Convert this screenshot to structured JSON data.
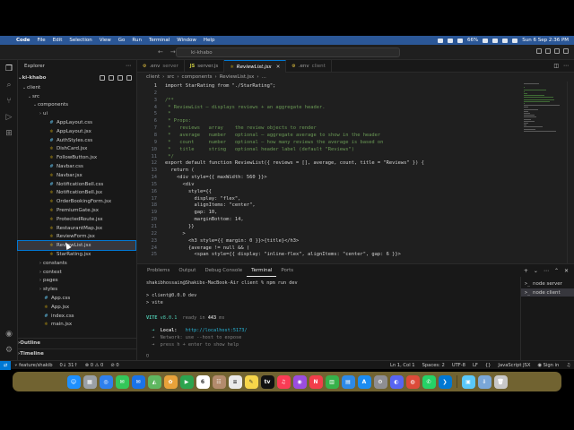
{
  "menubar": {
    "app_name": "Code",
    "items": [
      "File",
      "Edit",
      "Selection",
      "View",
      "Go",
      "Run",
      "Terminal",
      "Window",
      "Help"
    ],
    "battery": "66%",
    "datetime": "Sun 6 Sep  2:36 PM"
  },
  "titlebar": {
    "search_text": "ki-khabo"
  },
  "sidebar": {
    "title": "Explorer",
    "project": "ki-khabo",
    "tree": [
      {
        "name": "client",
        "type": "folder",
        "open": true
      },
      {
        "name": "src",
        "type": "folder",
        "open": true
      },
      {
        "name": "components",
        "type": "folder",
        "open": true
      },
      {
        "name": "ui",
        "type": "folder",
        "open": false
      },
      {
        "name": "AppLayout.css",
        "type": "css"
      },
      {
        "name": "AppLayout.jsx",
        "type": "jsx"
      },
      {
        "name": "AuthStyles.css",
        "type": "css"
      },
      {
        "name": "DishCard.jsx",
        "type": "jsx"
      },
      {
        "name": "FollowButton.jsx",
        "type": "jsx"
      },
      {
        "name": "Navbar.css",
        "type": "css"
      },
      {
        "name": "Navbar.jsx",
        "type": "jsx"
      },
      {
        "name": "NotificationBell.css",
        "type": "css"
      },
      {
        "name": "NotificationBell.jsx",
        "type": "jsx"
      },
      {
        "name": "OrderBookingForm.jsx",
        "type": "jsx"
      },
      {
        "name": "PremiumGate.jsx",
        "type": "jsx"
      },
      {
        "name": "ProtectedRoute.jsx",
        "type": "jsx"
      },
      {
        "name": "RestaurantMap.jsx",
        "type": "jsx"
      },
      {
        "name": "ReviewForm.jsx",
        "type": "jsx"
      },
      {
        "name": "ReviewList.jsx",
        "type": "jsx",
        "selected": true
      },
      {
        "name": "StarRating.jsx",
        "type": "jsx"
      },
      {
        "name": "constants",
        "type": "folder",
        "open": false
      },
      {
        "name": "context",
        "type": "folder",
        "open": false
      },
      {
        "name": "pages",
        "type": "folder",
        "open": false
      },
      {
        "name": "styles",
        "type": "folder",
        "open": false
      },
      {
        "name": "App.css",
        "type": "css"
      },
      {
        "name": "App.jsx",
        "type": "jsx"
      },
      {
        "name": "index.css",
        "type": "css"
      },
      {
        "name": "main.jsx",
        "type": "jsx"
      }
    ],
    "outline_label": "Outline",
    "timeline_label": "Timeline"
  },
  "tabs": [
    {
      "name": ".env",
      "suffix": "server",
      "icon": "env"
    },
    {
      "name": "server.js",
      "suffix": "",
      "icon": "JS"
    },
    {
      "name": "ReviewList.jsx",
      "suffix": "",
      "icon": "jsx",
      "active": true
    },
    {
      "name": ".env",
      "suffix": "client",
      "icon": "env"
    }
  ],
  "breadcrumb": [
    "client",
    "src",
    "components",
    "ReviewList.jsx",
    "..."
  ],
  "editor": {
    "lines": [
      {
        "n": "1",
        "text": "import StarRating from \"./StarRating\";",
        "kind": "code"
      },
      {
        "n": "2",
        "text": "",
        "kind": "code"
      },
      {
        "n": "3",
        "text": "/**",
        "kind": "comment"
      },
      {
        "n": "4",
        "text": " * ReviewList — displays reviews + an aggregate header.",
        "kind": "comment"
      },
      {
        "n": "5",
        "text": " *",
        "kind": "comment"
      },
      {
        "n": "6",
        "text": " * Props:",
        "kind": "comment"
      },
      {
        "n": "7",
        "text": " *   reviews   array    the review objects to render",
        "kind": "comment"
      },
      {
        "n": "8",
        "text": " *   average   number   optional — aggregate average to show in the header",
        "kind": "comment"
      },
      {
        "n": "9",
        "text": " *   count     number   optional — how many reviews the average is based on",
        "kind": "comment"
      },
      {
        "n": "10",
        "text": " *   title     string   optional header label (default \"Reviews\")",
        "kind": "comment"
      },
      {
        "n": "11",
        "text": " */",
        "kind": "comment"
      },
      {
        "n": "12",
        "text": "export default function ReviewList({ reviews = [], average, count, title = \"Reviews\" }) {",
        "kind": "code"
      },
      {
        "n": "13",
        "text": "  return (",
        "kind": "code"
      },
      {
        "n": "14",
        "text": "    <div style={{ maxWidth: 560 }}>",
        "kind": "code"
      },
      {
        "n": "15",
        "text": "      <div",
        "kind": "code"
      },
      {
        "n": "16",
        "text": "        style={{",
        "kind": "code"
      },
      {
        "n": "17",
        "text": "          display: \"flex\",",
        "kind": "code"
      },
      {
        "n": "18",
        "text": "          alignItems: \"center\",",
        "kind": "code"
      },
      {
        "n": "19",
        "text": "          gap: 10,",
        "kind": "code"
      },
      {
        "n": "20",
        "text": "          marginBottom: 14,",
        "kind": "code"
      },
      {
        "n": "21",
        "text": "        }}",
        "kind": "code"
      },
      {
        "n": "22",
        "text": "      >",
        "kind": "code"
      },
      {
        "n": "23",
        "text": "        <h3 style={{ margin: 0 }}>{title}</h3>",
        "kind": "code"
      },
      {
        "n": "24",
        "text": "        {average != null && (",
        "kind": "code"
      },
      {
        "n": "25",
        "text": "          <span style={{ display: \"inline-flex\", alignItems: \"center\", gap: 6 }}>",
        "kind": "code"
      }
    ]
  },
  "panel": {
    "tabs": [
      "Problems",
      "Output",
      "Debug Console",
      "Terminal",
      "Ports"
    ],
    "active_tab": "Terminal",
    "terminal": {
      "prompt": "shakibhossain@Shakibs-MacBook-Air client % npm run dev",
      "script_line1": "> client@0.0.0 dev",
      "script_line2": "> vite",
      "vite_label": "VITE",
      "vite_version": "v8.0.1",
      "ready_text": "ready in",
      "ready_ms": "443",
      "ready_unit": "ms",
      "local_label": "Local:",
      "local_url": "http://localhost:5173/",
      "network_label": "Network:",
      "network_text": "use --host to expose",
      "help_text": "press h + enter to show help"
    },
    "terminal_list": [
      "node server",
      "node client"
    ]
  },
  "statusbar": {
    "branch": "feature/shakib",
    "sync": "0↓ 31↑",
    "errors": "0",
    "warnings": "0",
    "ports": "0",
    "position": "Ln 1, Col 1",
    "spaces": "Spaces: 2",
    "encoding": "UTF-8",
    "eol": "LF",
    "braces": "{}",
    "language": "JavaScript JSX",
    "sign_in": "Sign in"
  },
  "dock": {
    "apps": [
      {
        "icon": "finder",
        "color": "#1e90ff",
        "glyph": "☺"
      },
      {
        "icon": "launchpad",
        "color": "#9aa0a6",
        "glyph": "▦"
      },
      {
        "icon": "safari",
        "color": "#2f80ed",
        "glyph": "◎"
      },
      {
        "icon": "messages",
        "color": "#34c759",
        "glyph": "✉"
      },
      {
        "icon": "mail",
        "color": "#1a73e8",
        "glyph": "✉"
      },
      {
        "icon": "maps",
        "color": "#5fb760",
        "glyph": "◭"
      },
      {
        "icon": "photos",
        "color": "#e8a23a",
        "glyph": "✿"
      },
      {
        "icon": "facetime",
        "color": "#2ca44e",
        "glyph": "▶"
      },
      {
        "icon": "calendar",
        "color": "#ffffff",
        "glyph": "6"
      },
      {
        "icon": "contacts",
        "color": "#b38b6d",
        "glyph": "☷"
      },
      {
        "icon": "reminders",
        "color": "#eaeaea",
        "glyph": "≡"
      },
      {
        "icon": "notes",
        "color": "#f6d54a",
        "glyph": "✎"
      },
      {
        "icon": "tv",
        "color": "#111111",
        "glyph": "tv"
      },
      {
        "icon": "music",
        "color": "#fa3c55",
        "glyph": "♫"
      },
      {
        "icon": "podcasts",
        "color": "#9b4de0",
        "glyph": "◉"
      },
      {
        "icon": "news",
        "color": "#f23e4a",
        "glyph": "N"
      },
      {
        "icon": "numbers",
        "color": "#36b24a",
        "glyph": "▥"
      },
      {
        "icon": "keynote",
        "color": "#2d8ae8",
        "glyph": "▤"
      },
      {
        "icon": "app-store",
        "color": "#1b8cf2",
        "glyph": "A"
      },
      {
        "icon": "system-settings",
        "color": "#8e8e93",
        "glyph": "⚙"
      },
      {
        "icon": "discord",
        "color": "#5865f2",
        "glyph": "◐"
      },
      {
        "icon": "chrome",
        "color": "#dd4b39",
        "glyph": "◍"
      },
      {
        "icon": "whatsapp",
        "color": "#25d366",
        "glyph": "✆"
      },
      {
        "icon": "vscode",
        "color": "#0078d4",
        "glyph": "❯"
      },
      {
        "icon": "preview",
        "color": "#5ac8fa",
        "glyph": "▣"
      },
      {
        "icon": "downloads",
        "color": "#7aa7d8",
        "glyph": "⇩"
      },
      {
        "icon": "trash",
        "color": "#c8c8c8",
        "glyph": "🗑"
      }
    ]
  },
  "colors": {
    "accent": "#0078d4",
    "editor_bg": "#1f1f1f",
    "sidebar_bg": "#181818",
    "comment": "#6a9955",
    "menubar_bg": "#2b5797"
  }
}
